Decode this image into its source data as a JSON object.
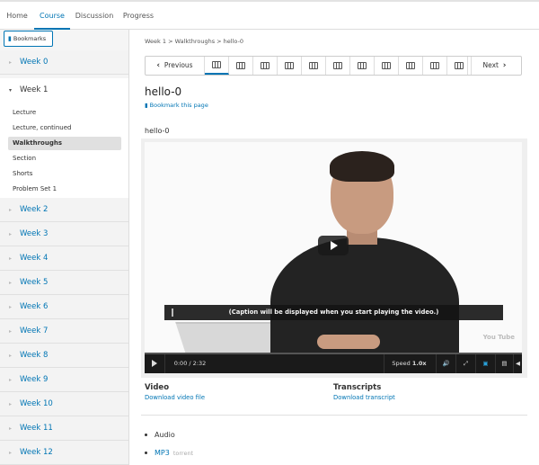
{
  "topnav": {
    "tabs": [
      "Home",
      "Course",
      "Discussion",
      "Progress"
    ],
    "active": "Course"
  },
  "sidebar": {
    "bookmarks_label": "Bookmarks",
    "weeks": [
      "Week 0",
      "Week 1",
      "Week 2",
      "Week 3",
      "Week 4",
      "Week 5",
      "Week 6",
      "Week 7",
      "Week 8",
      "Week 9",
      "Week 10",
      "Week 11",
      "Week 12"
    ],
    "open_week": "Week 1",
    "week1_items": [
      "Lecture",
      "Lecture, continued",
      "Walkthroughs",
      "Section",
      "Shorts",
      "Problem Set 1"
    ],
    "active_item": "Walkthroughs"
  },
  "main": {
    "breadcrumb": "Week 1 > Walkthroughs > hello-0",
    "prev_label": "Previous",
    "next_label": "Next",
    "sequence_count": 11,
    "active_sequence_index": 1,
    "unit_title": "hello-0",
    "bookmark_link": "Bookmark this page",
    "vertical_title": "hello-0",
    "caption_text": "(Caption will be displayed when you start playing the video.)",
    "watermark": "You Tube",
    "time": "0:00 / 2:32",
    "speed_label": "Speed",
    "speed_value": "1.0x",
    "video_heading": "Video",
    "download_video": "Download video file",
    "transcripts_heading": "Transcripts",
    "download_transcript": "Download transcript",
    "audio_label": "Audio",
    "mp3_label": "MP3",
    "torrent_label": "torrent"
  },
  "colors": {
    "link": "#0075b4",
    "active_tab": "#0075b4",
    "player_bar": "#1a1a1a",
    "hd_on": "#2a9fd6"
  },
  "icons": [
    "bookmark-icon",
    "chevron-left-icon",
    "chevron-right-icon",
    "film-icon",
    "play-icon",
    "volume-icon",
    "fullscreen-icon",
    "hd-icon",
    "cc-icon",
    "caption-toggle-icon"
  ]
}
